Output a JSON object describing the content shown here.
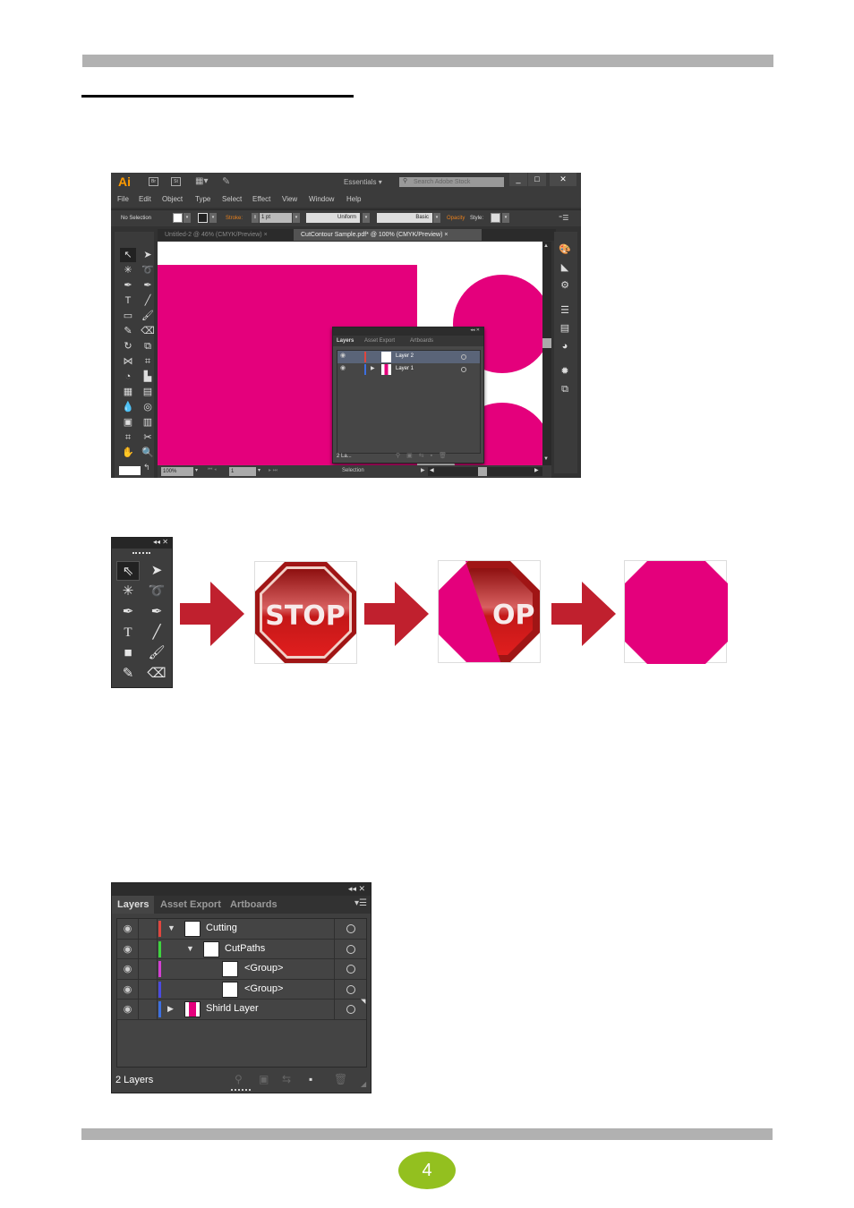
{
  "page": {
    "page_number": "4",
    "colors": {
      "rule": "#b1b1b1",
      "page_badge": "#93c01f",
      "magenta": "#e4007c",
      "arrow": "#c0202e"
    }
  },
  "illustrator": {
    "logo": "Ai",
    "bridge_btn": "Br",
    "stock_btn": "St",
    "workspace": "Essentials",
    "search_placeholder": "Search Adobe Stock",
    "window_controls": [
      "_",
      "□",
      "✕"
    ],
    "menu": [
      "File",
      "Edit",
      "Object",
      "Type",
      "Select",
      "Effect",
      "View",
      "Window",
      "Help"
    ],
    "control_bar": {
      "selection": "No Selection",
      "stroke_label": "Stroke:",
      "stroke_weight": "1 pt",
      "profile": "Uniform",
      "brush": "Basic",
      "opacity_label": "Opacity",
      "style_label": "Style:"
    },
    "tabs": [
      {
        "label": "Untitled-2 @ 46% (CMYK/Preview)",
        "close": "×",
        "active": false
      },
      {
        "label": "CutContour Sample.pdf* @ 100% (CMYK/Preview)",
        "close": "×",
        "active": true
      }
    ],
    "status": {
      "zoom": "100%",
      "artboard": "1",
      "tool": "Selection"
    },
    "layers_panel": {
      "tabs": [
        "Layers",
        "Asset Export",
        "Artboards"
      ],
      "rows": [
        {
          "name": "Layer 2",
          "color": "#e0463e",
          "selected": true,
          "expandable": false
        },
        {
          "name": "Layer 1",
          "color": "#3d6fe0",
          "selected": false,
          "expandable": true
        }
      ],
      "footer": "2 La..."
    }
  },
  "toolbox_closeup": {
    "tools": [
      "Selection",
      "Direct Selection",
      "Magic Wand",
      "Lasso",
      "Pen",
      "Curvature",
      "Type",
      "Line Segment",
      "Rectangle",
      "Paintbrush",
      "Shaper",
      "Eraser"
    ]
  },
  "steps": {
    "stop_text": "STOP",
    "partial_text": "OP"
  },
  "layers_closeup": {
    "tabs": [
      "Layers",
      "Asset Export",
      "Artboards"
    ],
    "rows": [
      {
        "name": "Cutting",
        "color": "#e0463e",
        "level": 0,
        "expanded": true
      },
      {
        "name": "CutPaths",
        "color": "#3ed43e",
        "level": 1,
        "expanded": true
      },
      {
        "name": "<Group>",
        "color": "#d43ed4",
        "level": 2
      },
      {
        "name": "<Group>",
        "color": "#4b4be0",
        "level": 2
      },
      {
        "name": "Shirld Layer",
        "color": "#3d6fe0",
        "level": 0,
        "expanded": false
      }
    ],
    "footer": "2 Layers"
  }
}
